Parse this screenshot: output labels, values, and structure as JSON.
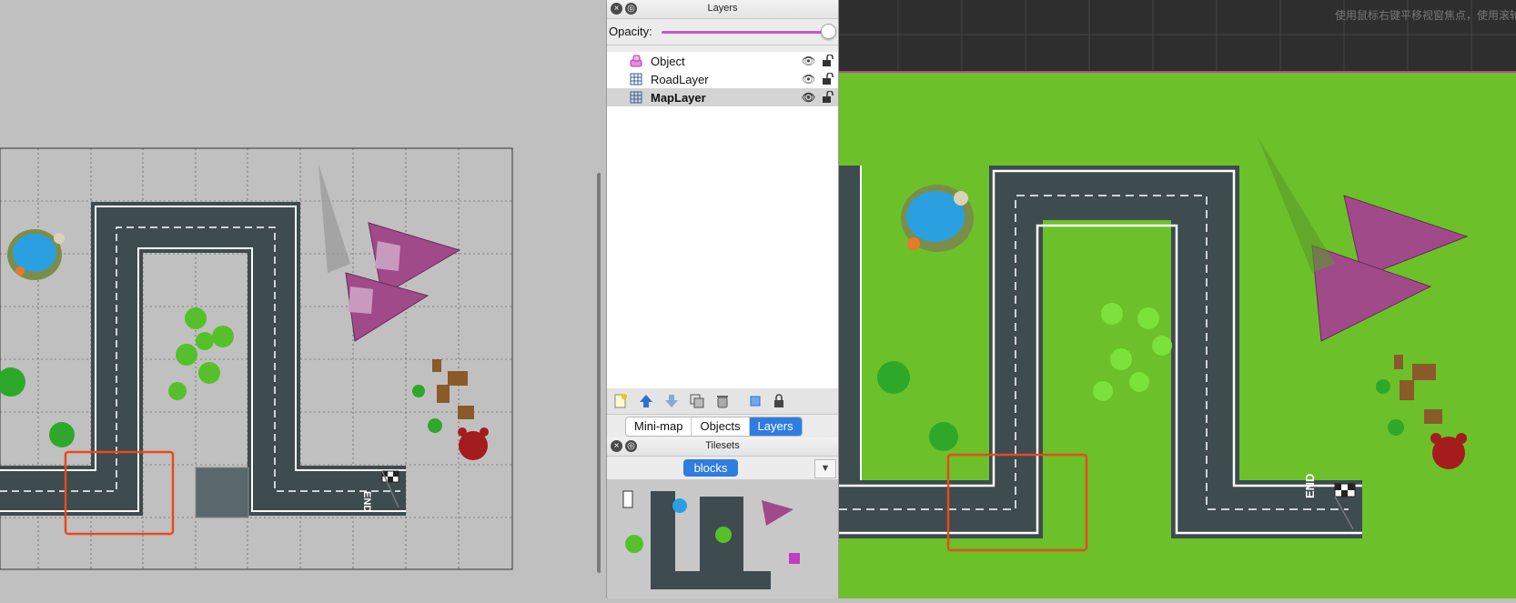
{
  "layers_panel": {
    "title": "Layers",
    "opacity_label": "Opacity:",
    "opacity_value": 1.0,
    "layers": [
      {
        "name": "Object",
        "type": "object-layer",
        "visible": true,
        "selected": false
      },
      {
        "name": "RoadLayer",
        "type": "tile-layer",
        "visible": true,
        "selected": false
      },
      {
        "name": "MapLayer",
        "type": "tile-layer",
        "visible": true,
        "selected": true
      }
    ]
  },
  "bottom_tabs": {
    "items": [
      "Mini-map",
      "Objects",
      "Layers"
    ],
    "active": "Layers"
  },
  "tilesets_panel": {
    "title": "Tilesets",
    "active_tileset": "blocks"
  },
  "preview": {
    "hint_text": "使用鼠标右键平移视窗焦点，使用滚轮"
  },
  "map_labels": {
    "end_label": "END"
  },
  "colors": {
    "accent": "#2f7de1",
    "opacity_slider": "#c45ac7",
    "road": "#3e4b4f",
    "grass": "#6cc02a",
    "selection_frame": "#e84a1c",
    "editor_background": "#c0c0c0"
  }
}
